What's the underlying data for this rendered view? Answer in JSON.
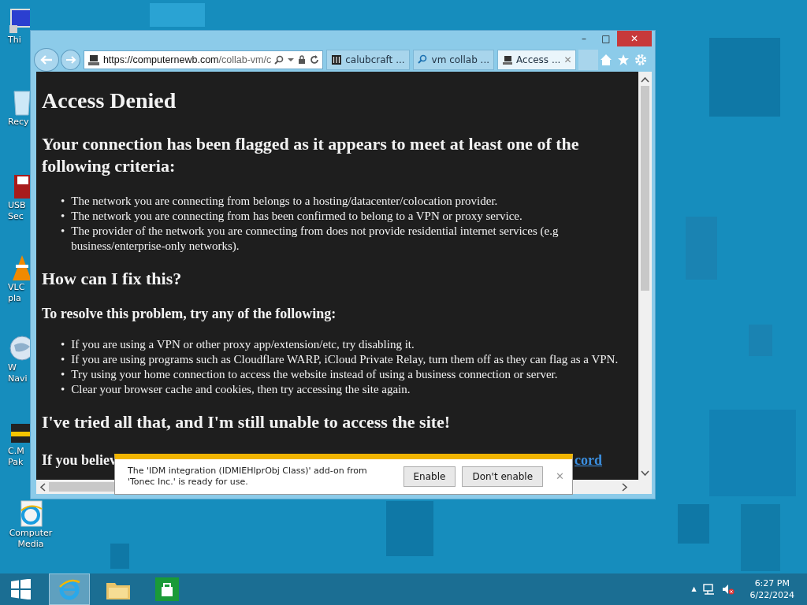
{
  "desktop_icons": [
    {
      "kind": "pc",
      "lines": [
        "Thi"
      ]
    },
    {
      "kind": "bin",
      "lines": [
        "Recy"
      ]
    },
    {
      "kind": "usb",
      "lines": [
        "USB",
        "Sec"
      ]
    },
    {
      "kind": "vlc",
      "lines": [
        "VLC",
        "pla"
      ]
    },
    {
      "kind": "globe",
      "lines": [
        "W",
        "Navi"
      ]
    },
    {
      "kind": "cm",
      "lines": [
        "C.M",
        "Pak"
      ]
    },
    {
      "kind": "ie",
      "lines": [
        "Computer",
        "Media"
      ]
    }
  ],
  "window": {
    "controls": [
      "–",
      "□",
      "✕"
    ],
    "address": {
      "host": "https://computernewb.com",
      "path": "/collab-vm/c"
    },
    "tabs": [
      {
        "kind": "columns",
        "label": "calubcraft ...",
        "selected": false
      },
      {
        "kind": "search",
        "label": "vm collab ...",
        "selected": false
      },
      {
        "kind": "site",
        "label": "Access ...",
        "selected": true,
        "close": "✕"
      }
    ],
    "content": {
      "title": "Access Denied",
      "bullet": "•",
      "heading": "Your connection has been flagged as it appears to meet at least one of the following criteria:",
      "criteria": [
        "The network you are connecting from belongs to a hosting/datacenter/colocation provider.",
        "The network you are connecting from has been confirmed to belong to a VPN or proxy service.",
        "The provider of the network you are connecting from does not provide residential internet services (e.g business/enterprise-only networks)."
      ],
      "fix_heading": "How can I fix this?",
      "fix_intro": "To resolve this problem, try any of the following:",
      "fixes": [
        "If you are using a VPN or other proxy app/extension/etc, try disabling it.",
        "If you are using programs such as Cloudflare WARP, iCloud Private Relay, turn them off as they can flag as a VPN.",
        "Try using your home connection to access the website instead of using a business connection or server.",
        "Clear your browser cache and cookies, then try accessing the site again."
      ],
      "still_heading": "I've tried all that, and I'm still unable to access the site!",
      "last_text": "If you believ",
      "last_link": "cord"
    },
    "notification": {
      "message": "The 'IDM integration (IDMIEHlprObj Class)' add-on from 'Tonec Inc.' is ready for use.",
      "buttons": [
        "Enable",
        "Don't enable"
      ],
      "close": "✕"
    }
  },
  "taskbar": {
    "items": [
      {
        "kind": "start",
        "selected": false
      },
      {
        "kind": "ie",
        "selected": true
      },
      {
        "kind": "folder",
        "selected": false
      },
      {
        "kind": "store",
        "selected": false
      }
    ],
    "tray_caret": "▲",
    "time": "6:27 PM",
    "date": "6/22/2024"
  }
}
